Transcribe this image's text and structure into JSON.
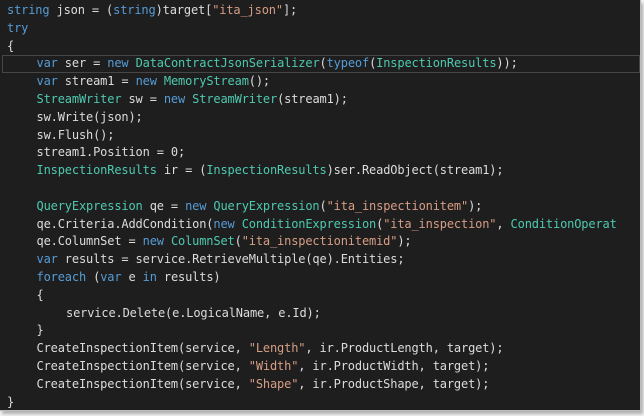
{
  "editor": {
    "colors": {
      "background": "#1e1e1e",
      "keyword": "#569cd6",
      "type": "#4ec9b0",
      "string": "#d69d85",
      "text": "#dcdcdc"
    },
    "current_line_index": 3,
    "lines": [
      {
        "indent": 0,
        "tokens": [
          {
            "k": "kw",
            "t": "string"
          },
          {
            "k": "pl",
            "t": " json = ("
          },
          {
            "k": "kw",
            "t": "string"
          },
          {
            "k": "pl",
            "t": ")target["
          },
          {
            "k": "st",
            "t": "\"ita_json\""
          },
          {
            "k": "pl",
            "t": "];"
          }
        ]
      },
      {
        "indent": 0,
        "tokens": [
          {
            "k": "kw",
            "t": "try"
          }
        ]
      },
      {
        "indent": 0,
        "tokens": [
          {
            "k": "pl",
            "t": "{"
          }
        ]
      },
      {
        "indent": 1,
        "tokens": [
          {
            "k": "kw",
            "t": "var"
          },
          {
            "k": "pl",
            "t": " ser = "
          },
          {
            "k": "kw",
            "t": "new"
          },
          {
            "k": "pl",
            "t": " "
          },
          {
            "k": "ty",
            "t": "DataContractJsonSerializer"
          },
          {
            "k": "pl",
            "t": "("
          },
          {
            "k": "kw",
            "t": "typeof"
          },
          {
            "k": "pl",
            "t": "("
          },
          {
            "k": "ty",
            "t": "InspectionResults"
          },
          {
            "k": "pl",
            "t": "));"
          }
        ]
      },
      {
        "indent": 1,
        "tokens": [
          {
            "k": "kw",
            "t": "var"
          },
          {
            "k": "pl",
            "t": " stream1 = "
          },
          {
            "k": "kw",
            "t": "new"
          },
          {
            "k": "pl",
            "t": " "
          },
          {
            "k": "ty",
            "t": "MemoryStream"
          },
          {
            "k": "pl",
            "t": "();"
          }
        ]
      },
      {
        "indent": 1,
        "tokens": [
          {
            "k": "ty",
            "t": "StreamWriter"
          },
          {
            "k": "pl",
            "t": " sw = "
          },
          {
            "k": "kw",
            "t": "new"
          },
          {
            "k": "pl",
            "t": " "
          },
          {
            "k": "ty",
            "t": "StreamWriter"
          },
          {
            "k": "pl",
            "t": "(stream1);"
          }
        ]
      },
      {
        "indent": 1,
        "tokens": [
          {
            "k": "pl",
            "t": "sw.Write(json);"
          }
        ]
      },
      {
        "indent": 1,
        "tokens": [
          {
            "k": "pl",
            "t": "sw.Flush();"
          }
        ]
      },
      {
        "indent": 1,
        "tokens": [
          {
            "k": "pl",
            "t": "stream1.Position = 0;"
          }
        ]
      },
      {
        "indent": 1,
        "tokens": [
          {
            "k": "ty",
            "t": "InspectionResults"
          },
          {
            "k": "pl",
            "t": " ir = ("
          },
          {
            "k": "ty",
            "t": "InspectionResults"
          },
          {
            "k": "pl",
            "t": ")ser.ReadObject(stream1);"
          }
        ]
      },
      {
        "indent": 0,
        "tokens": []
      },
      {
        "indent": 1,
        "tokens": [
          {
            "k": "ty",
            "t": "QueryExpression"
          },
          {
            "k": "pl",
            "t": " qe = "
          },
          {
            "k": "kw",
            "t": "new"
          },
          {
            "k": "pl",
            "t": " "
          },
          {
            "k": "ty",
            "t": "QueryExpression"
          },
          {
            "k": "pl",
            "t": "("
          },
          {
            "k": "st",
            "t": "\"ita_inspectionitem\""
          },
          {
            "k": "pl",
            "t": ");"
          }
        ]
      },
      {
        "indent": 1,
        "tokens": [
          {
            "k": "pl",
            "t": "qe.Criteria.AddCondition("
          },
          {
            "k": "kw",
            "t": "new"
          },
          {
            "k": "pl",
            "t": " "
          },
          {
            "k": "ty",
            "t": "ConditionExpression"
          },
          {
            "k": "pl",
            "t": "("
          },
          {
            "k": "st",
            "t": "\"ita_inspection\""
          },
          {
            "k": "pl",
            "t": ", "
          },
          {
            "k": "ty",
            "t": "ConditionOperat"
          }
        ]
      },
      {
        "indent": 1,
        "tokens": [
          {
            "k": "pl",
            "t": "qe.ColumnSet = "
          },
          {
            "k": "kw",
            "t": "new"
          },
          {
            "k": "pl",
            "t": " "
          },
          {
            "k": "ty",
            "t": "ColumnSet"
          },
          {
            "k": "pl",
            "t": "("
          },
          {
            "k": "st",
            "t": "\"ita_inspectionitemid\""
          },
          {
            "k": "pl",
            "t": ");"
          }
        ]
      },
      {
        "indent": 1,
        "tokens": [
          {
            "k": "kw",
            "t": "var"
          },
          {
            "k": "pl",
            "t": " results = service.RetrieveMultiple(qe).Entities;"
          }
        ]
      },
      {
        "indent": 1,
        "tokens": [
          {
            "k": "kw",
            "t": "foreach"
          },
          {
            "k": "pl",
            "t": " ("
          },
          {
            "k": "kw",
            "t": "var"
          },
          {
            "k": "pl",
            "t": " e "
          },
          {
            "k": "kw",
            "t": "in"
          },
          {
            "k": "pl",
            "t": " results)"
          }
        ]
      },
      {
        "indent": 1,
        "tokens": [
          {
            "k": "pl",
            "t": "{"
          }
        ]
      },
      {
        "indent": 2,
        "tokens": [
          {
            "k": "pl",
            "t": "service.Delete(e.LogicalName, e.Id);"
          }
        ]
      },
      {
        "indent": 1,
        "tokens": [
          {
            "k": "pl",
            "t": "}"
          }
        ]
      },
      {
        "indent": 1,
        "tokens": [
          {
            "k": "pl",
            "t": "CreateInspectionItem(service, "
          },
          {
            "k": "st",
            "t": "\"Length\""
          },
          {
            "k": "pl",
            "t": ", ir.ProductLength, target);"
          }
        ]
      },
      {
        "indent": 1,
        "tokens": [
          {
            "k": "pl",
            "t": "CreateInspectionItem(service, "
          },
          {
            "k": "st",
            "t": "\"Width\""
          },
          {
            "k": "pl",
            "t": ", ir.ProductWidth, target);"
          }
        ]
      },
      {
        "indent": 1,
        "tokens": [
          {
            "k": "pl",
            "t": "CreateInspectionItem(service, "
          },
          {
            "k": "st",
            "t": "\"Shape\""
          },
          {
            "k": "pl",
            "t": ", ir.ProductShape, target);"
          }
        ]
      },
      {
        "indent": 0,
        "tokens": [
          {
            "k": "pl",
            "t": "}"
          }
        ]
      }
    ]
  }
}
